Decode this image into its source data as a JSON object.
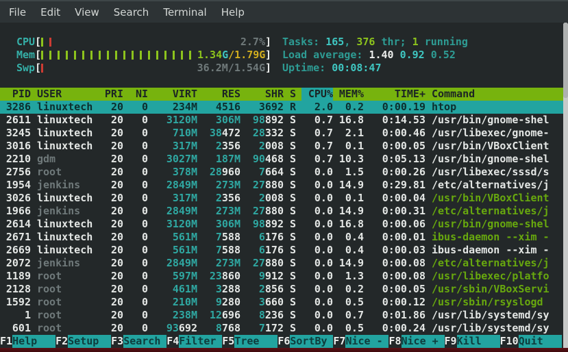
{
  "menu_bar": {
    "items": [
      "File",
      "Edit",
      "View",
      "Search",
      "Terminal",
      "Help"
    ]
  },
  "meters": {
    "bracket_open": "[",
    "bracket_close": "]",
    "rows": [
      {
        "name": "cpu",
        "label": "CPU",
        "ticks": [
          {
            "color": "green",
            "count": 1
          },
          {
            "color": "red",
            "count": 1
          }
        ],
        "text": [
          {
            "t": "2.7%",
            "cls": "dim"
          }
        ]
      },
      {
        "name": "mem",
        "label": "Mem",
        "ticks": [
          {
            "color": "green",
            "count": 19
          }
        ],
        "text": [
          {
            "t": "1.34",
            "cls": "green"
          },
          {
            "t": "G",
            "cls": "cyan"
          },
          {
            "t": "/1.79G",
            "cls": "yellow"
          }
        ]
      },
      {
        "name": "swp",
        "label": "Swp",
        "ticks": [
          {
            "color": "red",
            "count": 1
          }
        ],
        "text": [
          {
            "t": "36.2M/1.54G",
            "cls": "dim"
          }
        ]
      }
    ]
  },
  "stats": {
    "rows": [
      {
        "name": "tasks-summary",
        "parts": [
          {
            "t": "Tasks: ",
            "cls": "teal"
          },
          {
            "t": "165",
            "cls": "cyan"
          },
          {
            "t": ", ",
            "cls": "teal"
          },
          {
            "t": "376",
            "cls": "green"
          },
          {
            "t": " thr; ",
            "cls": "teal"
          },
          {
            "t": "1",
            "cls": "green"
          },
          {
            "t": " running",
            "cls": "teal"
          }
        ]
      },
      {
        "name": "load-average",
        "parts": [
          {
            "t": "Load average: ",
            "cls": "teal"
          },
          {
            "t": "1.40 ",
            "cls": "white"
          },
          {
            "t": "0.92 ",
            "cls": "cyan"
          },
          {
            "t": "0.52",
            "cls": "teal"
          }
        ]
      },
      {
        "name": "uptime",
        "parts": [
          {
            "t": "Uptime: ",
            "cls": "teal"
          },
          {
            "t": "00:08:47",
            "cls": "cyan"
          }
        ]
      }
    ]
  },
  "table": {
    "columns": [
      "PID",
      "USER",
      "PRI",
      "NI",
      "VIRT",
      "RES",
      "SHR",
      "S",
      "CPU%",
      "MEM%",
      "TIME+",
      "Command"
    ],
    "sort_column": "CPU%",
    "rows": [
      {
        "pid": "3286",
        "user": "linuxtech",
        "pri": "20",
        "ni": "0",
        "virt_hi": "234M",
        "virt_lo": "",
        "res_hi": "4516",
        "res_lo": "",
        "shr_hi": "3692",
        "shr_lo": "",
        "s": "R",
        "cpu": "2.0",
        "mem": "0.2",
        "time": "0:00.19",
        "cmd": "htop",
        "selected": true,
        "user_dim": false,
        "cmd_green": false
      },
      {
        "pid": "2611",
        "user": "linuxtech",
        "pri": "20",
        "ni": "0",
        "virt_hi": "3120M",
        "virt_lo": "",
        "res_hi": "306M",
        "res_lo": "",
        "shr_hi": "98",
        "shr_lo": "892",
        "s": "S",
        "cpu": "0.7",
        "mem": "16.8",
        "time": "0:14.53",
        "cmd": "/usr/bin/gnome-shel",
        "selected": false,
        "user_dim": false,
        "cmd_green": false
      },
      {
        "pid": "3245",
        "user": "linuxtech",
        "pri": "20",
        "ni": "0",
        "virt_hi": "710M",
        "virt_lo": "",
        "res_hi": "38",
        "res_lo": "472",
        "shr_hi": "28",
        "shr_lo": "332",
        "s": "S",
        "cpu": "0.7",
        "mem": "2.1",
        "time": "0:00.46",
        "cmd": "/usr/libexec/gnome-",
        "selected": false,
        "user_dim": false,
        "cmd_green": false
      },
      {
        "pid": "3016",
        "user": "linuxtech",
        "pri": "20",
        "ni": "0",
        "virt_hi": "317M",
        "virt_lo": "",
        "res_hi": "2",
        "res_lo": "356",
        "shr_hi": "2",
        "shr_lo": "008",
        "s": "S",
        "cpu": "0.7",
        "mem": "0.1",
        "time": "0:00.05",
        "cmd": "/usr/bin/VBoxClient",
        "selected": false,
        "user_dim": false,
        "cmd_green": false
      },
      {
        "pid": "2210",
        "user": "gdm",
        "pri": "20",
        "ni": "0",
        "virt_hi": "3027M",
        "virt_lo": "",
        "res_hi": "187M",
        "res_lo": "",
        "shr_hi": "90",
        "shr_lo": "468",
        "s": "S",
        "cpu": "0.7",
        "mem": "10.3",
        "time": "0:05.13",
        "cmd": "/usr/bin/gnome-shel",
        "selected": false,
        "user_dim": true,
        "cmd_green": false
      },
      {
        "pid": "2756",
        "user": "root",
        "pri": "20",
        "ni": "0",
        "virt_hi": "378M",
        "virt_lo": "",
        "res_hi": "28",
        "res_lo": "960",
        "shr_hi": "7",
        "shr_lo": "664",
        "s": "S",
        "cpu": "0.0",
        "mem": "1.5",
        "time": "0:00.26",
        "cmd": "/usr/libexec/sssd/s",
        "selected": false,
        "user_dim": true,
        "cmd_green": false
      },
      {
        "pid": "1954",
        "user": "jenkins",
        "pri": "20",
        "ni": "0",
        "virt_hi": "2849M",
        "virt_lo": "",
        "res_hi": "273M",
        "res_lo": "",
        "shr_hi": "27",
        "shr_lo": "880",
        "s": "S",
        "cpu": "0.0",
        "mem": "14.9",
        "time": "0:29.81",
        "cmd": "/etc/alternatives/j",
        "selected": false,
        "user_dim": true,
        "cmd_green": false
      },
      {
        "pid": "3026",
        "user": "linuxtech",
        "pri": "20",
        "ni": "0",
        "virt_hi": "317M",
        "virt_lo": "",
        "res_hi": "2",
        "res_lo": "356",
        "shr_hi": "2",
        "shr_lo": "008",
        "s": "S",
        "cpu": "0.0",
        "mem": "0.1",
        "time": "0:00.04",
        "cmd": "/usr/bin/VBoxClient",
        "selected": false,
        "user_dim": false,
        "cmd_green": true
      },
      {
        "pid": "1966",
        "user": "jenkins",
        "pri": "20",
        "ni": "0",
        "virt_hi": "2849M",
        "virt_lo": "",
        "res_hi": "273M",
        "res_lo": "",
        "shr_hi": "27",
        "shr_lo": "880",
        "s": "S",
        "cpu": "0.0",
        "mem": "14.9",
        "time": "0:00.31",
        "cmd": "/etc/alternatives/j",
        "selected": false,
        "user_dim": true,
        "cmd_green": true
      },
      {
        "pid": "2614",
        "user": "linuxtech",
        "pri": "20",
        "ni": "0",
        "virt_hi": "3120M",
        "virt_lo": "",
        "res_hi": "306M",
        "res_lo": "",
        "shr_hi": "98",
        "shr_lo": "892",
        "s": "S",
        "cpu": "0.0",
        "mem": "16.8",
        "time": "0:00.06",
        "cmd": "/usr/bin/gnome-shel",
        "selected": false,
        "user_dim": false,
        "cmd_green": true
      },
      {
        "pid": "2671",
        "user": "linuxtech",
        "pri": "20",
        "ni": "0",
        "virt_hi": "561M",
        "virt_lo": "",
        "res_hi": "7",
        "res_lo": "588",
        "shr_hi": "6",
        "shr_lo": "176",
        "s": "S",
        "cpu": "0.0",
        "mem": "0.4",
        "time": "0:00.01",
        "cmd": "ibus-daemon --xim -",
        "selected": false,
        "user_dim": false,
        "cmd_green": true
      },
      {
        "pid": "2669",
        "user": "linuxtech",
        "pri": "20",
        "ni": "0",
        "virt_hi": "561M",
        "virt_lo": "",
        "res_hi": "7",
        "res_lo": "588",
        "shr_hi": "6",
        "shr_lo": "176",
        "s": "S",
        "cpu": "0.0",
        "mem": "0.4",
        "time": "0:00.03",
        "cmd": "ibus-daemon --xim -",
        "selected": false,
        "user_dim": false,
        "cmd_green": false
      },
      {
        "pid": "2072",
        "user": "jenkins",
        "pri": "20",
        "ni": "0",
        "virt_hi": "2849M",
        "virt_lo": "",
        "res_hi": "273M",
        "res_lo": "",
        "shr_hi": "27",
        "shr_lo": "880",
        "s": "S",
        "cpu": "0.0",
        "mem": "14.9",
        "time": "0:00.08",
        "cmd": "/etc/alternatives/j",
        "selected": false,
        "user_dim": true,
        "cmd_green": true
      },
      {
        "pid": "1189",
        "user": "root",
        "pri": "20",
        "ni": "0",
        "virt_hi": "597M",
        "virt_lo": "",
        "res_hi": "23",
        "res_lo": "860",
        "shr_hi": "9",
        "shr_lo": "912",
        "s": "S",
        "cpu": "0.0",
        "mem": "1.3",
        "time": "0:00.08",
        "cmd": "/usr/libexec/platfo",
        "selected": false,
        "user_dim": true,
        "cmd_green": true
      },
      {
        "pid": "2128",
        "user": "root",
        "pri": "20",
        "ni": "0",
        "virt_hi": "461M",
        "virt_lo": "",
        "res_hi": "3",
        "res_lo": "288",
        "shr_hi": "2",
        "shr_lo": "856",
        "s": "S",
        "cpu": "0.0",
        "mem": "0.2",
        "time": "0:00.05",
        "cmd": "/usr/sbin/VBoxServi",
        "selected": false,
        "user_dim": true,
        "cmd_green": true
      },
      {
        "pid": "1592",
        "user": "root",
        "pri": "20",
        "ni": "0",
        "virt_hi": "210M",
        "virt_lo": "",
        "res_hi": "9",
        "res_lo": "280",
        "shr_hi": "3",
        "shr_lo": "660",
        "s": "S",
        "cpu": "0.0",
        "mem": "0.5",
        "time": "0:00.12",
        "cmd": "/usr/sbin/rsyslogd",
        "selected": false,
        "user_dim": true,
        "cmd_green": true
      },
      {
        "pid": "1",
        "user": "root",
        "pri": "20",
        "ni": "0",
        "virt_hi": "238M",
        "virt_lo": "",
        "res_hi": "12",
        "res_lo": "696",
        "shr_hi": "8",
        "shr_lo": "236",
        "s": "S",
        "cpu": "0.0",
        "mem": "0.7",
        "time": "0:01.86",
        "cmd": "/usr/lib/systemd/sy",
        "selected": false,
        "user_dim": true,
        "cmd_green": false
      },
      {
        "pid": "601",
        "user": "root",
        "pri": "20",
        "ni": "0",
        "virt_hi": "93",
        "virt_lo": "692",
        "res_hi": "8",
        "res_lo": "768",
        "shr_hi": "7",
        "shr_lo": "172",
        "s": "S",
        "cpu": "0.0",
        "mem": "0.5",
        "time": "0:00.24",
        "cmd": "/usr/lib/systemd/sy",
        "selected": false,
        "user_dim": true,
        "cmd_green": false
      }
    ]
  },
  "fkeys": [
    {
      "key": "F1",
      "label": "Help"
    },
    {
      "key": "F2",
      "label": "Setup"
    },
    {
      "key": "F3",
      "label": "Search"
    },
    {
      "key": "F4",
      "label": "Filter"
    },
    {
      "key": "F5",
      "label": "Tree"
    },
    {
      "key": "F6",
      "label": "SortBy"
    },
    {
      "key": "F7",
      "label": "Nice -"
    },
    {
      "key": "F8",
      "label": "Nice +"
    },
    {
      "key": "F9",
      "label": "Kill"
    },
    {
      "key": "F10",
      "label": "Quit"
    }
  ],
  "colors": {
    "accent_cyan": "#22a4a0",
    "header_green": "#77b30e",
    "bar_green": "#8dc41d",
    "bar_red": "#cc3b33",
    "value_cyan": "#2fa8a2",
    "bright_cyan": "#3fc6c1",
    "teal": "#2e9c94",
    "yellow": "#d2ae1e",
    "dim_gray": "#6f797a",
    "text_white": "#e4e7e5",
    "thread_green": "#68a90e",
    "selected_text": "#0c2e2e"
  }
}
